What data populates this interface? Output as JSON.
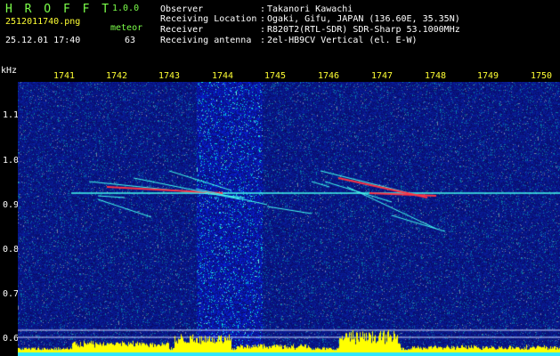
{
  "header": {
    "app_name": "H R O F F T",
    "version": "1.0.0",
    "filename": "2512011740.png",
    "datetime": "25.12.01 17:40",
    "meteor_label": "meteor",
    "meteor_count": "63",
    "info": [
      {
        "key": "Observer",
        "value": "Takanori Kawachi"
      },
      {
        "key": "Receiving Location",
        "value": "Ogaki, Gifu, JAPAN (136.60E, 35.35N)"
      },
      {
        "key": "Receiver",
        "value": "R820T2(RTL-SDR) SDR-Sharp 53.1000MHz"
      },
      {
        "key": "Receiving antenna",
        "value": "2el-HB9CV Vertical (el. E-W)"
      }
    ]
  },
  "axis": {
    "unit_label": "kHz",
    "x_ticks": [
      "1741",
      "1742",
      "1743",
      "1744",
      "1745",
      "1746",
      "1747",
      "1748",
      "1749",
      "1750"
    ],
    "y_ticks": [
      "1.1",
      "1.0",
      "0.9",
      "0.8",
      "0.7",
      "0.6"
    ]
  },
  "colors": {
    "label_green": "#7CFF4A",
    "tick_yellow": "#ffff33",
    "background_blue": "#0a1a8a",
    "trace_cyan": "#44ffee",
    "trace_red": "#ff3344",
    "level_yellow": "#ffff00"
  }
}
